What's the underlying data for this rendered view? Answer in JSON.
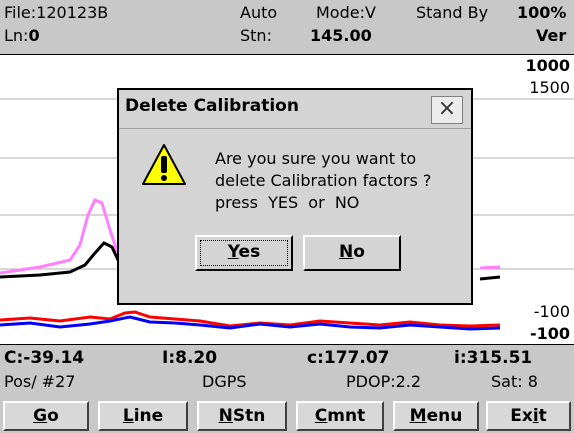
{
  "header": {
    "file_label": "File:",
    "file_value": "120123B",
    "mode_auto": "Auto",
    "mode_label": "Mode:V",
    "status": "Stand By",
    "battery": "100%",
    "line_label": "Ln:",
    "line_value": "0",
    "station_label": "Stn:",
    "station_value": "145.00",
    "view": "Ver"
  },
  "plot": {
    "scale_top": "1000",
    "scale_second": "1500",
    "scale_low": "-100",
    "scale_bottom": "-100"
  },
  "readout": {
    "c_upper": "C:-39.14",
    "i_upper": "I:8.20",
    "c_lower": "c:177.07",
    "i_lower": "i:315.51",
    "pos": "Pos/ #27",
    "gps": "DGPS",
    "pdop": "PDOP:2.2",
    "sat": "Sat: 8"
  },
  "buttons": {
    "go": {
      "first": "G",
      "rest": "o"
    },
    "line": {
      "first": "L",
      "rest": "ine"
    },
    "nstn": {
      "first": "N",
      "rest": "Stn"
    },
    "cmnt": {
      "first": "C",
      "rest": "mnt"
    },
    "menu": {
      "first": "M",
      "rest": "enu"
    },
    "exit": {
      "first": "E",
      "rest": "x",
      "u": "i",
      "tail": "t"
    }
  },
  "dialog": {
    "title": "Delete Calibration",
    "close": "×",
    "message_line1": "Are you sure you want to",
    "message_line2": "delete Calibration factors ?",
    "message_line3": "press  YES  or  NO",
    "yes": {
      "first": "Y",
      "rest": "es"
    },
    "no": {
      "first": "N",
      "rest": "o"
    }
  },
  "colors": {
    "panel_gray": "#c8c8c8",
    "trace_pink": "#ff80ff",
    "trace_black": "#000000",
    "trace_red": "#ff0000",
    "trace_blue": "#0000ff",
    "grid_gray": "#b0b0b0"
  },
  "icons": {
    "dialog_icon": "warning-icon",
    "close_icon": "close-icon"
  }
}
